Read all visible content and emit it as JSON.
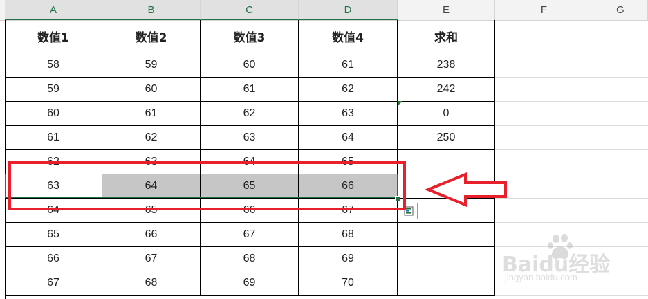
{
  "columns": [
    "A",
    "B",
    "C",
    "D",
    "E",
    "F",
    "G"
  ],
  "headers": [
    "数值1",
    "数值2",
    "数值3",
    "数值4",
    "求和"
  ],
  "rows": [
    [
      "58",
      "59",
      "60",
      "61",
      "238"
    ],
    [
      "59",
      "60",
      "61",
      "62",
      "242"
    ],
    [
      "60",
      "61",
      "62",
      "63",
      "0"
    ],
    [
      "61",
      "62",
      "63",
      "64",
      "250"
    ],
    [
      "62",
      "63",
      "64",
      "65",
      ""
    ],
    [
      "63",
      "64",
      "65",
      "66",
      ""
    ],
    [
      "64",
      "65",
      "66",
      "67",
      ""
    ],
    [
      "65",
      "66",
      "67",
      "68",
      ""
    ],
    [
      "66",
      "67",
      "68",
      "69",
      ""
    ],
    [
      "67",
      "68",
      "69",
      "70",
      ""
    ]
  ],
  "selected_row_index": 5,
  "colors": {
    "accent_green": "#217346",
    "annotation_red": "#e8202c",
    "selection_fill": "#c6c6c6"
  },
  "icons": {
    "quick_analysis": "quick-analysis-icon",
    "error_indicator": "error-indicator-icon",
    "annotation_arrow": "left-arrow-icon"
  },
  "watermark": {
    "brand": "Baidu经验",
    "url": "jingyan.baidu.com"
  }
}
